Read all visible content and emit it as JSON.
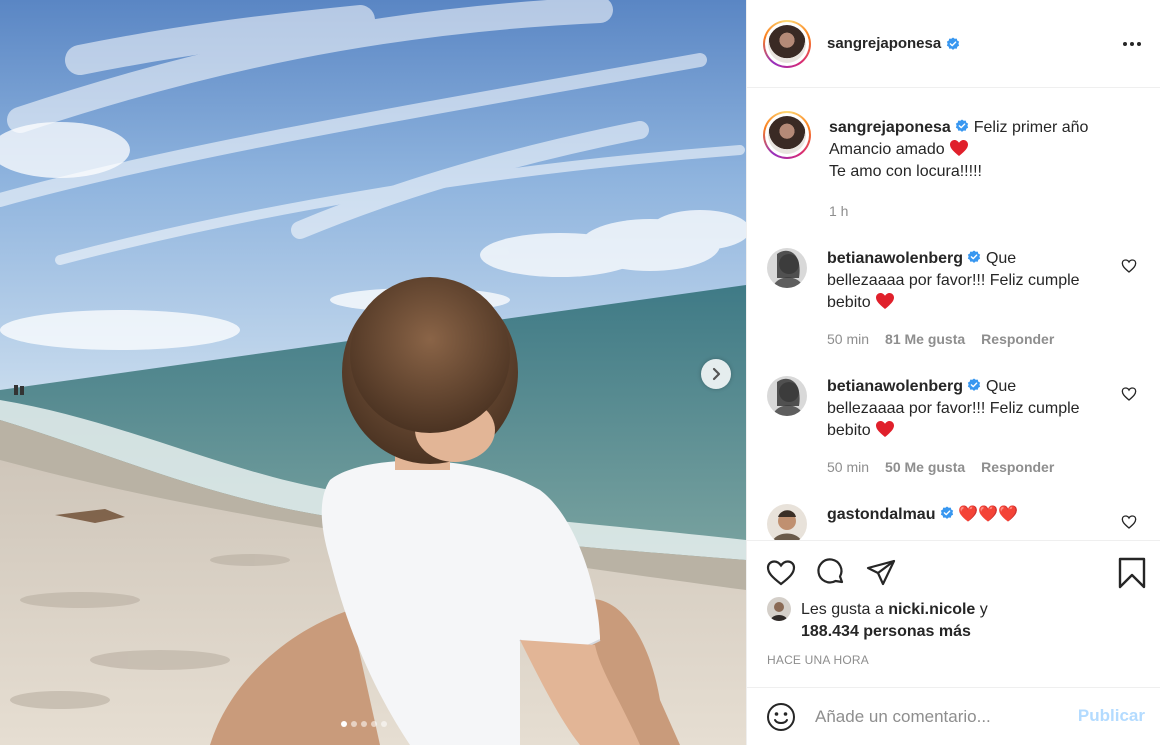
{
  "post": {
    "username": "sangrejaponesa",
    "verified": true,
    "more_icon": "more-horizontal-icon",
    "carousel": {
      "slide_count": 5,
      "active_slide": 1,
      "next_icon": "chevron-right-icon"
    }
  },
  "caption": {
    "username": "sangrejaponesa",
    "text_line1": "Feliz primer año",
    "text_line2": "Amancio amado",
    "emoji": "❤️",
    "text_line3": "Te amo con locura!!!!!",
    "time": "1 h"
  },
  "comments": [
    {
      "username": "betianawolenberg",
      "text": "Que bellezaaaa por favor!!! Feliz cumple bebito",
      "emoji": "❤️",
      "time": "50 min",
      "likes": "81 Me gusta",
      "reply": "Responder"
    },
    {
      "username": "betianawolenberg",
      "text": "Que bellezaaaa por favor!!! Feliz cumple bebito",
      "emoji": "❤️",
      "time": "50 min",
      "likes": "50 Me gusta",
      "reply": "Responder"
    },
    {
      "username": "gastondalmau",
      "text": "❤️❤️❤️"
    }
  ],
  "actions": {
    "like_icon": "heart-outline-icon",
    "comment_icon": "comment-icon",
    "share_icon": "paper-plane-icon",
    "save_icon": "bookmark-icon"
  },
  "likes_summary": {
    "prefix": "Les gusta a",
    "user": "nicki.nicole",
    "connector": "y",
    "others": "188.434 personas más"
  },
  "timestamp": "HACE UNA HORA",
  "add_comment": {
    "emoji_icon": "emoji-smile-icon",
    "placeholder": "Añade un comentario...",
    "publish_label": "Publicar"
  },
  "colors": {
    "verified": "#3897f0",
    "heart_red": "#ed4956",
    "publish_disabled": "#b3dbff",
    "muted": "#8e8e8e"
  }
}
